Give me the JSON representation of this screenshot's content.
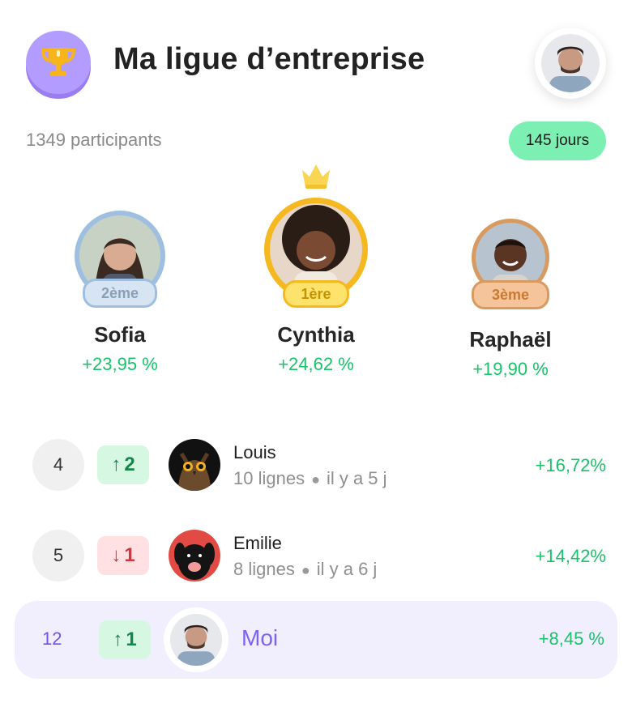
{
  "header": {
    "title": "Ma ligue d’entreprise",
    "trophy_icon": "trophy-icon",
    "profile_icon": "user-avatar"
  },
  "league": {
    "participants": "1349 participants",
    "days": "145 jours"
  },
  "colors": {
    "accent": "#7b63f5",
    "gain": "#19c36a",
    "gold": "#f5b81f",
    "silver": "#9fbfe0",
    "bronze": "#d79b62",
    "days_pill": "#7cf0b2"
  },
  "podium": {
    "first": {
      "rank_label": "1ère",
      "name": "Cynthia",
      "gain": "+24,62 %"
    },
    "second": {
      "rank_label": "2ème",
      "name": "Sofia",
      "gain": "+23,95 %"
    },
    "third": {
      "rank_label": "3ème",
      "name": "Raphaël",
      "gain": "+19,90 %"
    }
  },
  "leaderboard": [
    {
      "rank": "4",
      "move_dir": "up",
      "move_value": "2",
      "name": "Louis",
      "lines": "10 lignes",
      "ago": "il y a 5 j",
      "gain": "+16,72%",
      "avatar_icon": "owl-avatar"
    },
    {
      "rank": "5",
      "move_dir": "down",
      "move_value": "1",
      "name": "Emilie",
      "lines": "8 lignes",
      "ago": "il y a 6 j",
      "gain": "+14,42%",
      "avatar_icon": "dog-avatar"
    }
  ],
  "me": {
    "rank": "12",
    "move_dir": "up",
    "move_value": "1",
    "name": "Moi",
    "gain": "+8,45 %"
  }
}
